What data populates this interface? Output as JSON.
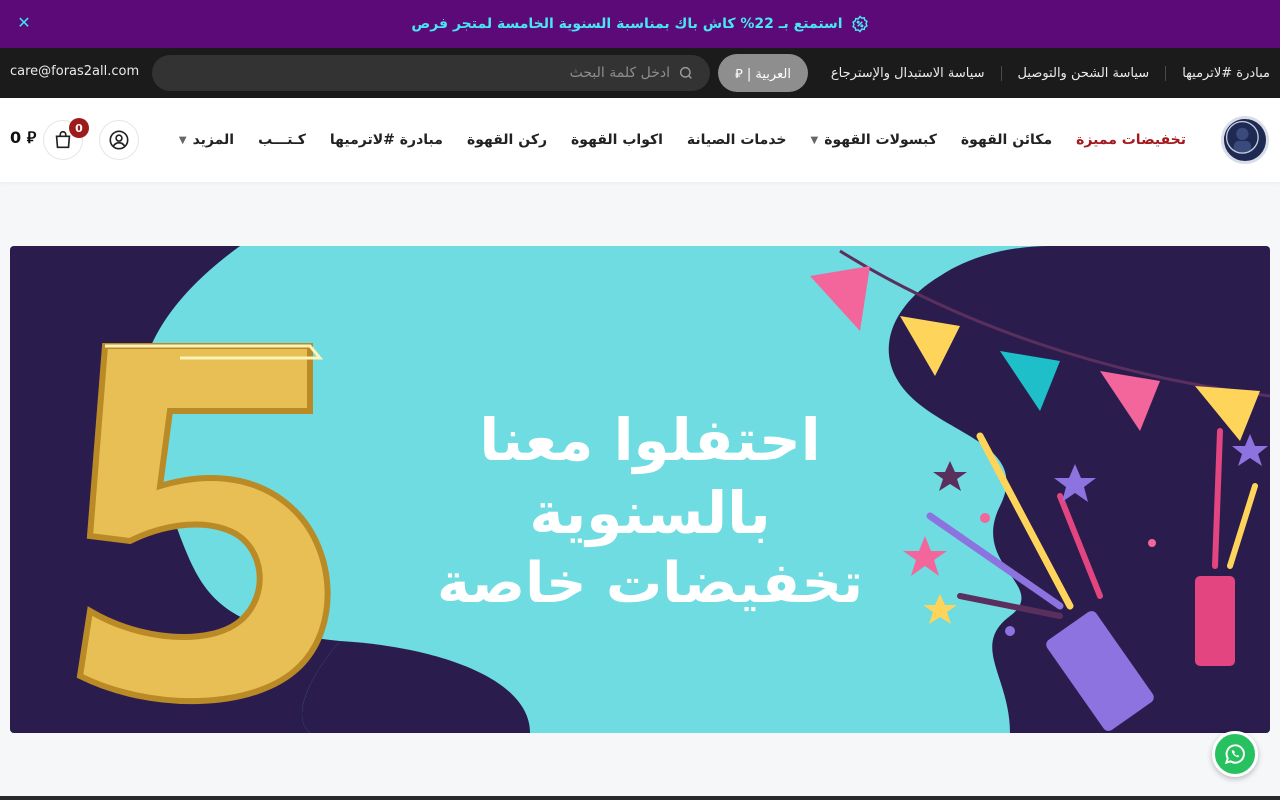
{
  "announcement": {
    "text": "استمتع بـ 22% كاش باك بمناسبة السنوية الخامسة لمتجر فرص",
    "close_icon": "close-icon",
    "icon": "discount-badge-icon"
  },
  "topbar": {
    "email": "care@foras2all.com",
    "search_placeholder": "ادخل كلمة البحث",
    "language_label": "العربية",
    "currency_symbol": "⃁",
    "language_display": "العربية | ⃁",
    "links": [
      "مبادرة #لاترميها",
      "سياسة الشحن والتوصيل",
      "سياسة الاستبدال والإسترجاع"
    ]
  },
  "header": {
    "nav": [
      {
        "label": "تخفيضات مميزة",
        "featured": true,
        "dropdown": false
      },
      {
        "label": "مكائن القهوة",
        "featured": false,
        "dropdown": false
      },
      {
        "label": "كبسولات القهوة",
        "featured": false,
        "dropdown": true
      },
      {
        "label": "خدمات الصيانة",
        "featured": false,
        "dropdown": false
      },
      {
        "label": "اكواب القهوة",
        "featured": false,
        "dropdown": false
      },
      {
        "label": "ركن القهوة",
        "featured": false,
        "dropdown": false
      },
      {
        "label": "مبادرة #لاترميها",
        "featured": false,
        "dropdown": false
      },
      {
        "label": "كـتـــب",
        "featured": false,
        "dropdown": false
      },
      {
        "label": "المزيد",
        "featured": false,
        "dropdown": true
      }
    ],
    "cart_count": "0",
    "cart_total": "0 ⃁"
  },
  "banner": {
    "line1": "احتفلوا معنا بالسنوية",
    "line2": "تخفيضات خاصة",
    "number": "5"
  },
  "colors": {
    "announcement_bg": "#5c0a78",
    "announcement_text": "#49e6f2",
    "topbar_bg": "#1b1b1b",
    "featured_nav": "#a4191e",
    "banner_bg": "#6edce0",
    "banner_dark": "#2a1d4e",
    "whatsapp": "#27c25f"
  }
}
